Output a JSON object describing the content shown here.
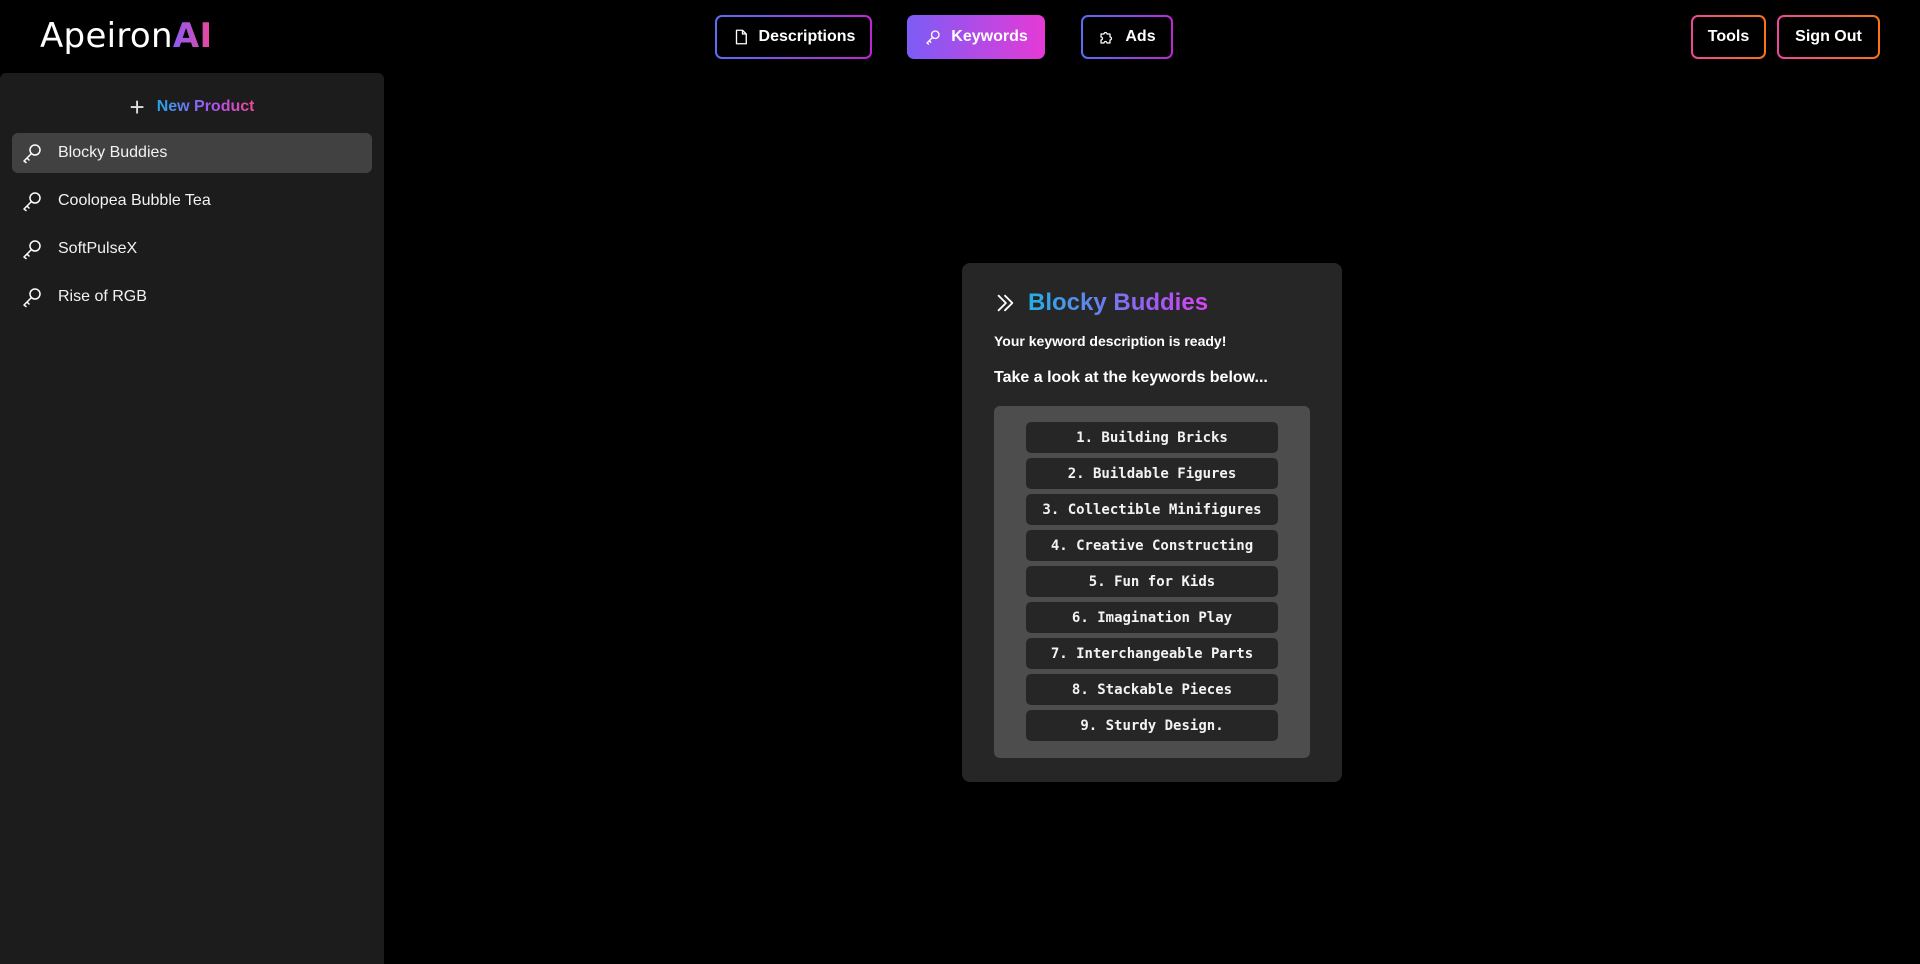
{
  "header": {
    "logo_main": "Apeiron",
    "logo_accent": "AI",
    "nav": {
      "descriptions": "Descriptions",
      "keywords": "Keywords",
      "ads": "Ads"
    },
    "tools": "Tools",
    "sign_out": "Sign Out"
  },
  "sidebar": {
    "new_product": "New Product",
    "items": [
      {
        "label": "Blocky Buddies"
      },
      {
        "label": "Coolopea Bubble Tea"
      },
      {
        "label": "SoftPulseX"
      },
      {
        "label": "Rise of RGB"
      }
    ]
  },
  "card": {
    "title": "Blocky Buddies",
    "ready_text": "Your keyword description is ready!",
    "look_text": "Take a look at the keywords below...",
    "keywords": [
      "1. Building Bricks",
      "2. Buildable Figures",
      "3. Collectible Minifigures",
      "4. Creative Constructing",
      "5. Fun for Kids",
      "6. Imagination Play",
      "7. Interchangeable Parts",
      "8. Stackable Pieces",
      "9. Sturdy Design."
    ]
  }
}
